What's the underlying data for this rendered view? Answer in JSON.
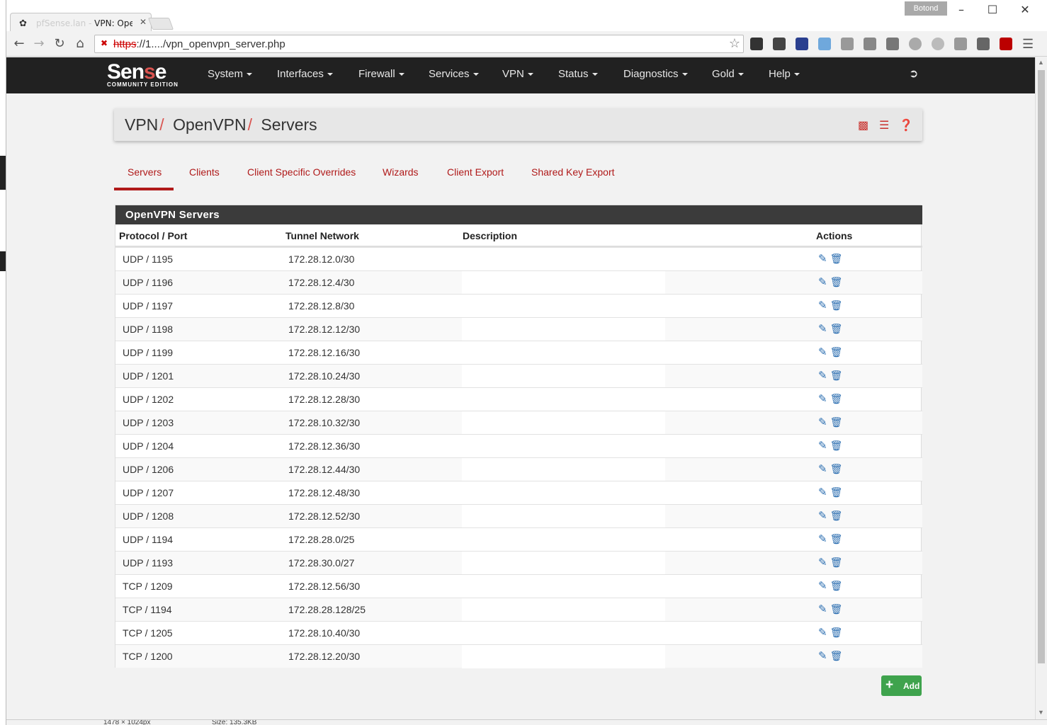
{
  "browser": {
    "tab_title": "VPN: OpenVPN: Servers",
    "tab_title_prefix": "pfSense.lan - ",
    "user_badge": "Botond",
    "url_scheme": "https",
    "url_rest": "://1..../vpn_openvpn_server.php"
  },
  "navbar": {
    "logo_main_a": "Sen",
    "logo_main_b": "s",
    "logo_main_c": "e",
    "logo_sub": "COMMUNITY EDITION",
    "items": [
      {
        "label": "System"
      },
      {
        "label": "Interfaces"
      },
      {
        "label": "Firewall"
      },
      {
        "label": "Services"
      },
      {
        "label": "VPN"
      },
      {
        "label": "Status"
      },
      {
        "label": "Diagnostics"
      },
      {
        "label": "Gold"
      },
      {
        "label": "Help"
      }
    ]
  },
  "breadcrumb": {
    "part1": "VPN",
    "part2": "OpenVPN",
    "part3": "Servers",
    "sep": "/"
  },
  "tabs": [
    {
      "label": "Servers",
      "active": true
    },
    {
      "label": "Clients"
    },
    {
      "label": "Client Specific Overrides"
    },
    {
      "label": "Wizards"
    },
    {
      "label": "Client Export"
    },
    {
      "label": "Shared Key Export"
    }
  ],
  "table": {
    "title": "OpenVPN Servers",
    "headers": {
      "protocol_port": "Protocol / Port",
      "tunnel_network": "Tunnel Network",
      "description": "Description",
      "actions": "Actions"
    },
    "rows": [
      {
        "proto": "UDP / 1195",
        "net": "172.28.12.0/30"
      },
      {
        "proto": "UDP / 1196",
        "net": "172.28.12.4/30"
      },
      {
        "proto": "UDP / 1197",
        "net": "172.28.12.8/30"
      },
      {
        "proto": "UDP / 1198",
        "net": "172.28.12.12/30"
      },
      {
        "proto": "UDP / 1199",
        "net": "172.28.12.16/30"
      },
      {
        "proto": "UDP / 1201",
        "net": "172.28.10.24/30"
      },
      {
        "proto": "UDP / 1202",
        "net": "172.28.12.28/30"
      },
      {
        "proto": "UDP / 1203",
        "net": "172.28.10.32/30"
      },
      {
        "proto": "UDP / 1204",
        "net": "172.28.12.36/30"
      },
      {
        "proto": "UDP / 1206",
        "net": "172.28.12.44/30"
      },
      {
        "proto": "UDP / 1207",
        "net": "172.28.12.48/30"
      },
      {
        "proto": "UDP / 1208",
        "net": "172.28.12.52/30"
      },
      {
        "proto": "UDP / 1194",
        "net": "172.28.28.0/25"
      },
      {
        "proto": "UDP / 1193",
        "net": "172.28.30.0/27"
      },
      {
        "proto": "TCP / 1209",
        "net": "172.28.12.56/30"
      },
      {
        "proto": "TCP / 1194",
        "net": "172.28.28.128/25"
      },
      {
        "proto": "TCP / 1205",
        "net": "172.28.10.40/30"
      },
      {
        "proto": "TCP / 1200",
        "net": "172.28.12.20/30"
      }
    ]
  },
  "add_button": {
    "label": "Add"
  },
  "statusbar": {
    "dimensions": "1478 × 1024px",
    "size": "Size: 135.3KB"
  }
}
